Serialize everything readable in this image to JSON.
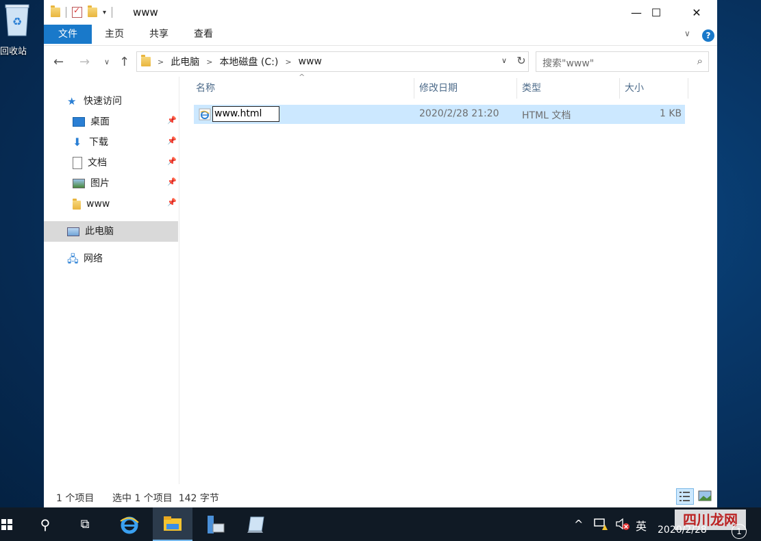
{
  "desktop": {
    "recycle_bin_label": "回收站"
  },
  "window": {
    "title": "www"
  },
  "ribbon": {
    "file": "文件",
    "home": "主页",
    "share": "共享",
    "view": "查看",
    "help": "?"
  },
  "address": {
    "crumbs": [
      "此电脑",
      "本地磁盘 (C:)",
      "www"
    ]
  },
  "search": {
    "placeholder": "搜索\"www\""
  },
  "nav": {
    "quick_access": "快速访问",
    "items": [
      "桌面",
      "下载",
      "文档",
      "图片",
      "www"
    ],
    "this_pc": "此电脑",
    "network": "网络"
  },
  "columns": {
    "name": "名称",
    "modified": "修改日期",
    "type": "类型",
    "size": "大小"
  },
  "files": [
    {
      "name": "www.html",
      "modified": "2020/2/28 21:20",
      "type": "HTML 文档",
      "size": "1 KB"
    }
  ],
  "status": {
    "count": "1 个项目",
    "selection": "选中 1 个项目  142 字节"
  },
  "taskbar": {
    "ime": "英",
    "date": "2020/2/28",
    "watermark": "四川龙网"
  }
}
